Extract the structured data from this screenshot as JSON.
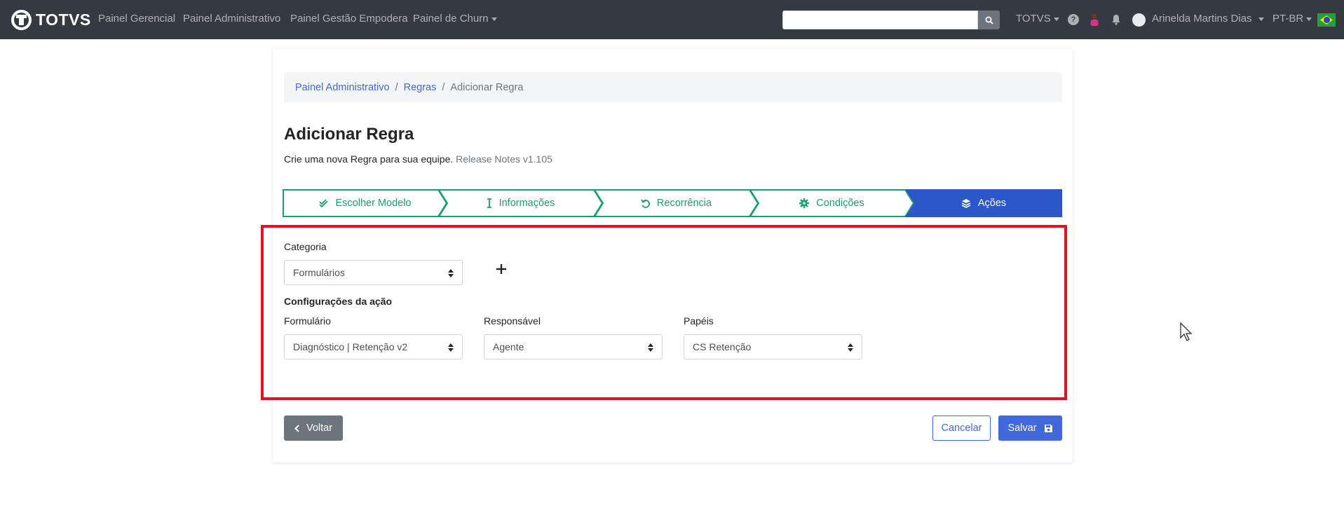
{
  "navbar": {
    "brand": "TOTVS",
    "links": [
      "Painel Gerencial",
      "Painel Administrativo",
      "Painel Gestão Empodera",
      "Painel de Churn"
    ],
    "search_placeholder": "",
    "org_menu": "TOTVS",
    "help_glyph": "?",
    "user_name": "Arinelda Martins Dias",
    "language": "PT-BR"
  },
  "breadcrumb": {
    "items": [
      "Painel Administrativo",
      "Regras"
    ],
    "current": "Adicionar Regra",
    "separator": "/"
  },
  "page": {
    "title": "Adicionar Regra",
    "subtitle": "Crie uma nova Regra para sua equipe.",
    "release": "Release Notes v1.105"
  },
  "stepper": {
    "steps": [
      {
        "label": "Escolher Modelo",
        "icon": "double-check-icon"
      },
      {
        "label": "Informações",
        "icon": "text-cursor-icon"
      },
      {
        "label": "Recorrência",
        "icon": "undo-icon"
      },
      {
        "label": "Condições",
        "icon": "gear-icon"
      },
      {
        "label": "Ações",
        "icon": "layers-icon"
      }
    ],
    "active_index": 4,
    "completed_color": "#1a9d74",
    "active_color": "#2b57c8"
  },
  "form": {
    "category_label": "Categoria",
    "category_value": "Formulários",
    "section_title": "Configurações da ação",
    "form_label": "Formulário",
    "form_value": "Diagnóstico | Retenção v2",
    "responsible_label": "Responsável",
    "responsible_value": "Agente",
    "roles_label": "Papéis",
    "roles_value": "CS Retenção"
  },
  "actions": {
    "back": "Voltar",
    "cancel": "Cancelar",
    "save": "Salvar"
  },
  "colors": {
    "navbar_bg": "#343a40",
    "primary": "#4169d9",
    "highlight_border": "#e8101b"
  }
}
